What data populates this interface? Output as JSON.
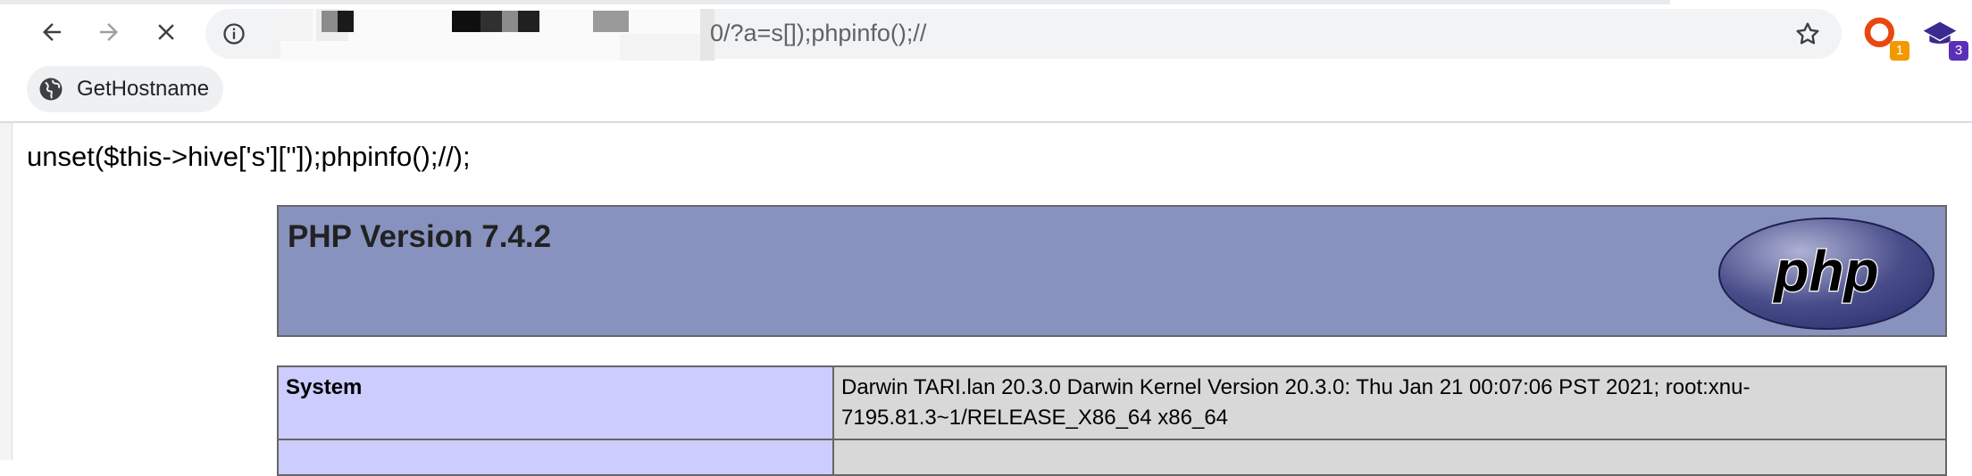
{
  "browser": {
    "url_visible": "0/?a=s[]);phpinfo();//",
    "extensions": [
      {
        "name": "extension-1",
        "badge": "1",
        "badge_color": "#f29900"
      },
      {
        "name": "extension-2",
        "badge": "3",
        "badge_color": "#5b2fb8"
      }
    ],
    "bookmark_label": "GetHostname"
  },
  "page": {
    "echo_line": "unset($this->hive['s']['']);phpinfo();//);",
    "php_version": "PHP Version 7.4.2",
    "logo_text": "php",
    "table": [
      {
        "key": "System",
        "value": "Darwin TARI.lan 20.3.0 Darwin Kernel Version 20.3.0: Thu Jan 21 00:07:06 PST 2021; root:xnu-7195.81.3~1/RELEASE_X86_64 x86_64"
      }
    ]
  },
  "colors": {
    "header_bg": "#8892bf",
    "key_cell_bg": "#ccccff",
    "value_cell_bg": "#d8d8d8"
  }
}
